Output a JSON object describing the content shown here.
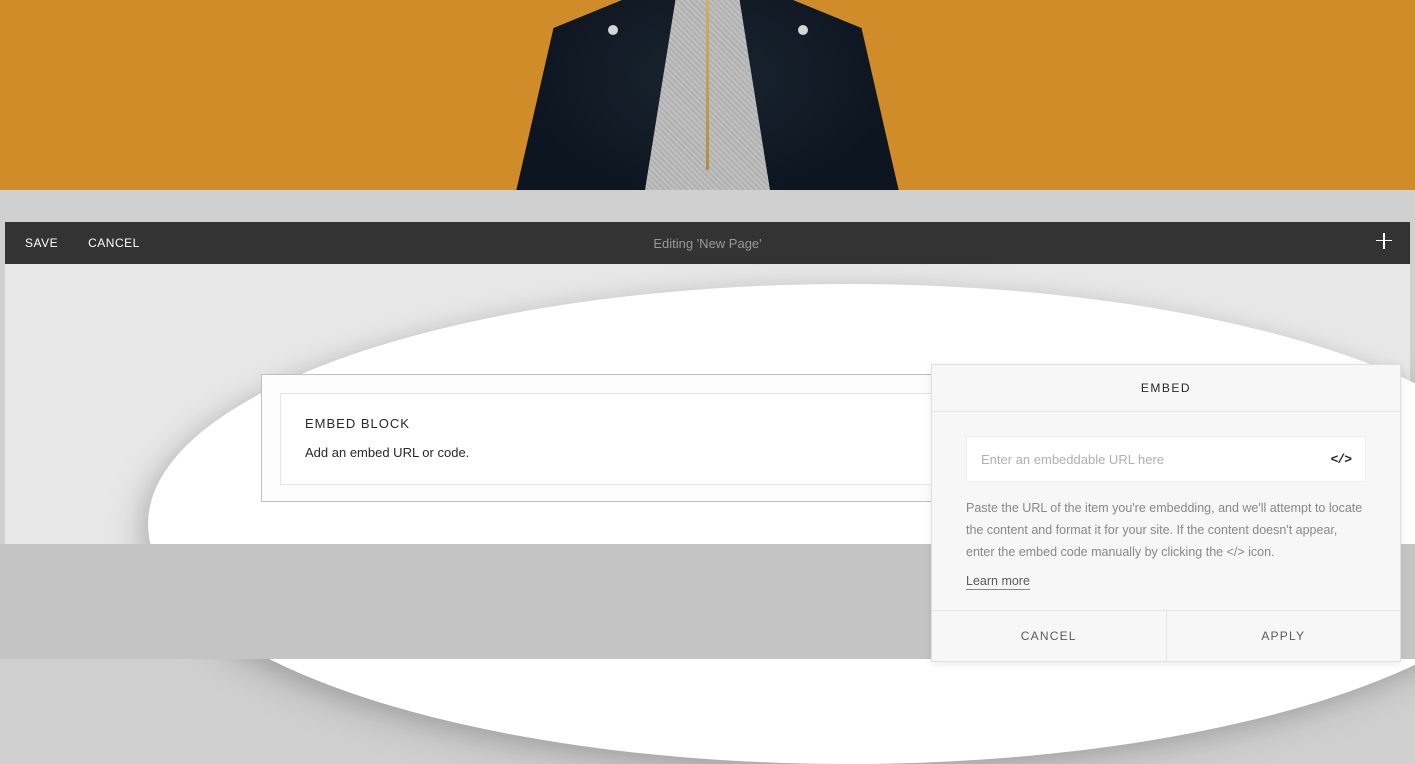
{
  "toolbar": {
    "save_label": "SAVE",
    "cancel_label": "CANCEL",
    "editing_text": "Editing 'New Page'"
  },
  "embed_block": {
    "title": "EMBED BLOCK",
    "description": "Add an embed URL or code."
  },
  "embed_panel": {
    "header": "EMBED",
    "input_placeholder": "Enter an embeddable URL here",
    "help_text": "Paste the URL of the item you're embedding, and we'll attempt to locate the content and format it for your site. If the content doesn't appear, enter the embed code manually by clicking the </> icon.",
    "learn_more_label": "Learn more",
    "cancel_label": "CANCEL",
    "apply_label": "APPLY",
    "code_icon_glyph": "</>"
  }
}
